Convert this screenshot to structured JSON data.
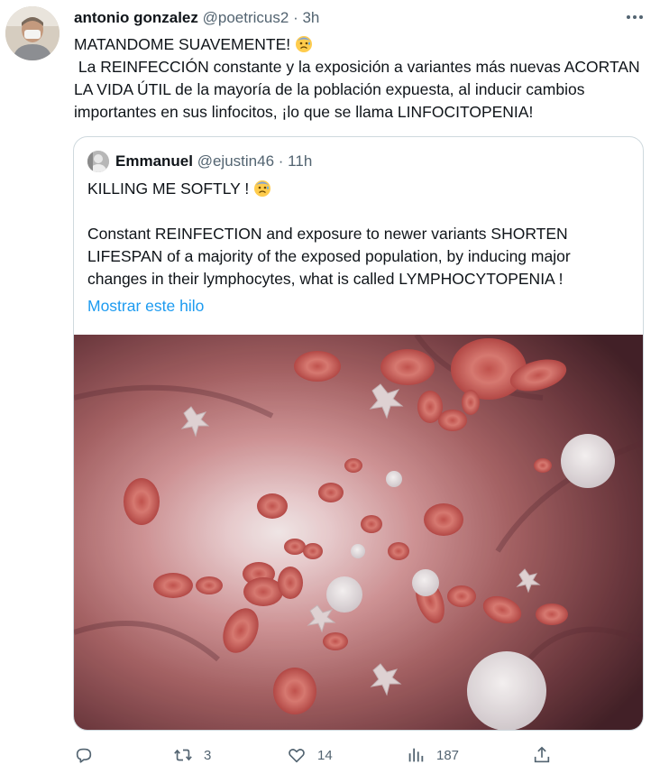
{
  "tweet": {
    "author_name": "antonio gonzalez",
    "handle": "@poetricus2",
    "separator": "·",
    "time": "3h",
    "text_line1": "MATANDOME SUAVEMENTE! ",
    "text_body": " La REINFECCIÓN constante y la exposición a variantes más nuevas ACORTAN LA VIDA ÚTIL de la mayoría de la población expuesta, al inducir cambios importantes en sus linfocitos, ¡lo que se llama LINFOCITOPENIA!",
    "emoji_icon": "anxious-face-with-sweat-icon"
  },
  "quote": {
    "author_name": "Emmanuel",
    "handle": "@ejustin46",
    "separator": "·",
    "time": "11h",
    "text_line1": "KILLING ME SOFTLY ! ",
    "text_body": "Constant REINFECTION and exposure to newer variants SHORTEN LIFESPAN of a majority of the exposed population, by inducing major changes in their lymphocytes, what is called LYMPHOCYTOPENIA !",
    "show_thread": "Mostrar este hilo",
    "media_icon": "blood-vessel-cells-image"
  },
  "actions": {
    "reply_icon": "reply-icon",
    "retweet_icon": "retweet-icon",
    "retweet_count": "3",
    "like_icon": "heart-icon",
    "like_count": "14",
    "views_icon": "views-bar-chart-icon",
    "views_count": "187",
    "share_icon": "share-icon"
  },
  "colors": {
    "text": "#0f1419",
    "muted": "#536471",
    "link": "#1d9bf0",
    "border": "#cfd9de"
  }
}
